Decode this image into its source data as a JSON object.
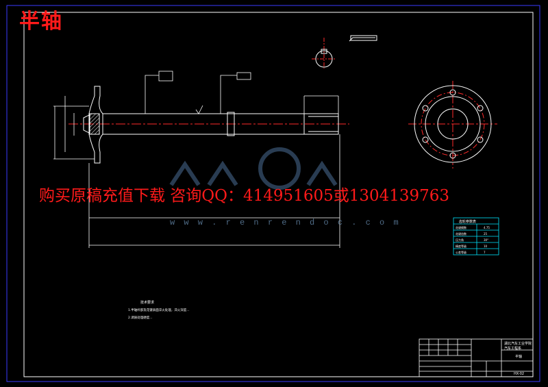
{
  "title": "半轴",
  "advert": "购买原稿充值下载 咨询QQ：414951605或1304139763",
  "watermark_url": "w w w . r e n r e n d o c . c o m",
  "watermark_brand": "人人文库",
  "tech_table": {
    "header": "齿轮参数表",
    "rows": [
      {
        "label": "花键模数",
        "value": "4.75"
      },
      {
        "label": "花键齿数",
        "value": "25"
      },
      {
        "label": "压力角",
        "value": "30°"
      },
      {
        "label": "精度等级",
        "value": "10"
      },
      {
        "label": "公差等级",
        "value": "7"
      }
    ]
  },
  "notes": {
    "heading": "技术要求",
    "line1": "1.半轴杆部及花键表面淬火处理，淬火深度...",
    "line2": "2.调质处理硬度..."
  },
  "title_block": {
    "school": "湖北汽车工业学院",
    "dept": "汽车工程系",
    "part_name": "半轴",
    "drawing_no": "HX-02"
  },
  "colors": {
    "background": "#000000",
    "frame": "#3a3aff",
    "lines": "#ffffff",
    "centerline": "#ff2a2a",
    "dimension": "#ffffff",
    "accent": "#00e5ff"
  }
}
